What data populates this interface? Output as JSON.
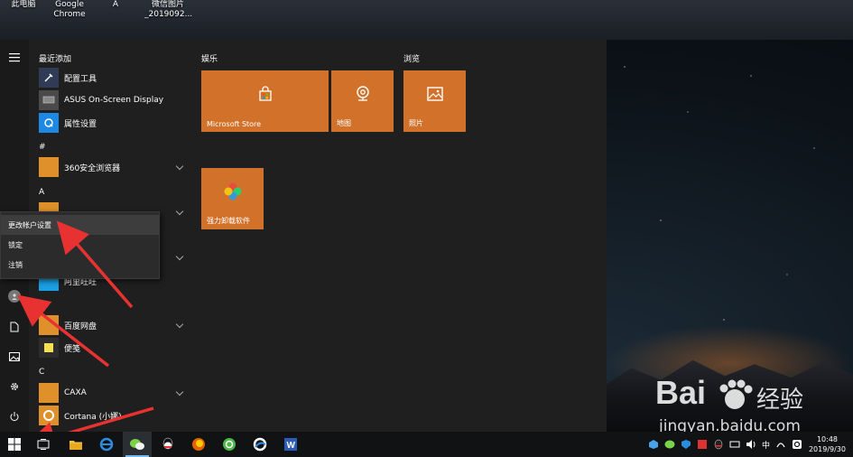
{
  "desktop": {
    "icons": [
      {
        "label": "此电脑",
        "icon": "computer-icon"
      },
      {
        "label": "Google Chrome",
        "icon": "chrome-icon"
      },
      {
        "label": "A",
        "icon": "file-icon"
      },
      {
        "label": "微信图片 _2019092...",
        "icon": "image-icon"
      }
    ]
  },
  "start_menu": {
    "recent_heading": "最近添加",
    "recent": [
      {
        "label": "配置工具",
        "icon": "tools-icon",
        "color": "#2f3b57"
      },
      {
        "label": "ASUS On-Screen Display",
        "icon": "asus-display-icon",
        "color": "#3a3a3a"
      },
      {
        "label": "属性设置",
        "icon": "settings-q-icon",
        "color": "#1e88e5"
      }
    ],
    "groups": [
      {
        "heading": "#",
        "items": [
          {
            "label": "360安全浏览器",
            "icon": "folder-icon",
            "color": "#e0902a",
            "expandable": true
          }
        ]
      },
      {
        "heading": "A",
        "items": [
          {
            "label": "",
            "icon": "folder-icon",
            "color": "#e0902a",
            "expandable": true
          }
        ]
      },
      {
        "heading": "",
        "items": [
          {
            "label": "",
            "icon": "folder-icon",
            "color": "#e0902a",
            "expandable": true
          },
          {
            "label": "阿里旺旺",
            "icon": "wangwang-icon",
            "color": "#1a9fe3",
            "expandable": false
          }
        ]
      },
      {
        "heading": "B",
        "items": [
          {
            "label": "百度网盘",
            "icon": "folder-icon",
            "color": "#e0902a",
            "expandable": true
          },
          {
            "label": "便笺",
            "icon": "sticky-notes-icon",
            "color": "#e0902a",
            "expandable": false
          }
        ]
      },
      {
        "heading": "C",
        "items": [
          {
            "label": "CAXA",
            "icon": "folder-icon",
            "color": "#e0902a",
            "expandable": true
          },
          {
            "label": "Cortana (小娜)",
            "icon": "cortana-icon",
            "color": "#e0902a",
            "expandable": false
          }
        ]
      }
    ],
    "tile_groups": [
      {
        "title": "娱乐",
        "tiles": [
          {
            "label": "Microsoft Store",
            "icon": "store-icon"
          },
          {
            "label": "地图",
            "icon": "maps-icon"
          },
          {
            "label": "强力卸载软件",
            "icon": "uninstall-icon"
          }
        ]
      },
      {
        "title": "浏览",
        "tiles": [
          {
            "label": "照片",
            "icon": "photos-icon"
          }
        ]
      }
    ],
    "account_flyout": {
      "items": [
        "更改帐户设置",
        "锁定",
        "注销"
      ]
    }
  },
  "taskbar": {
    "apps": [
      "file-explorer-icon",
      "ie-icon",
      "wechat-icon",
      "qq-icon",
      "firefox-icon",
      "360-browser-icon",
      "qq-browser-icon",
      "word-icon"
    ],
    "tray_lang": "中",
    "time": "10:48",
    "date": "2019/9/30"
  },
  "watermark": {
    "brand": "Bai",
    "brand2": "经验",
    "url": "jingyan.baidu.com"
  }
}
